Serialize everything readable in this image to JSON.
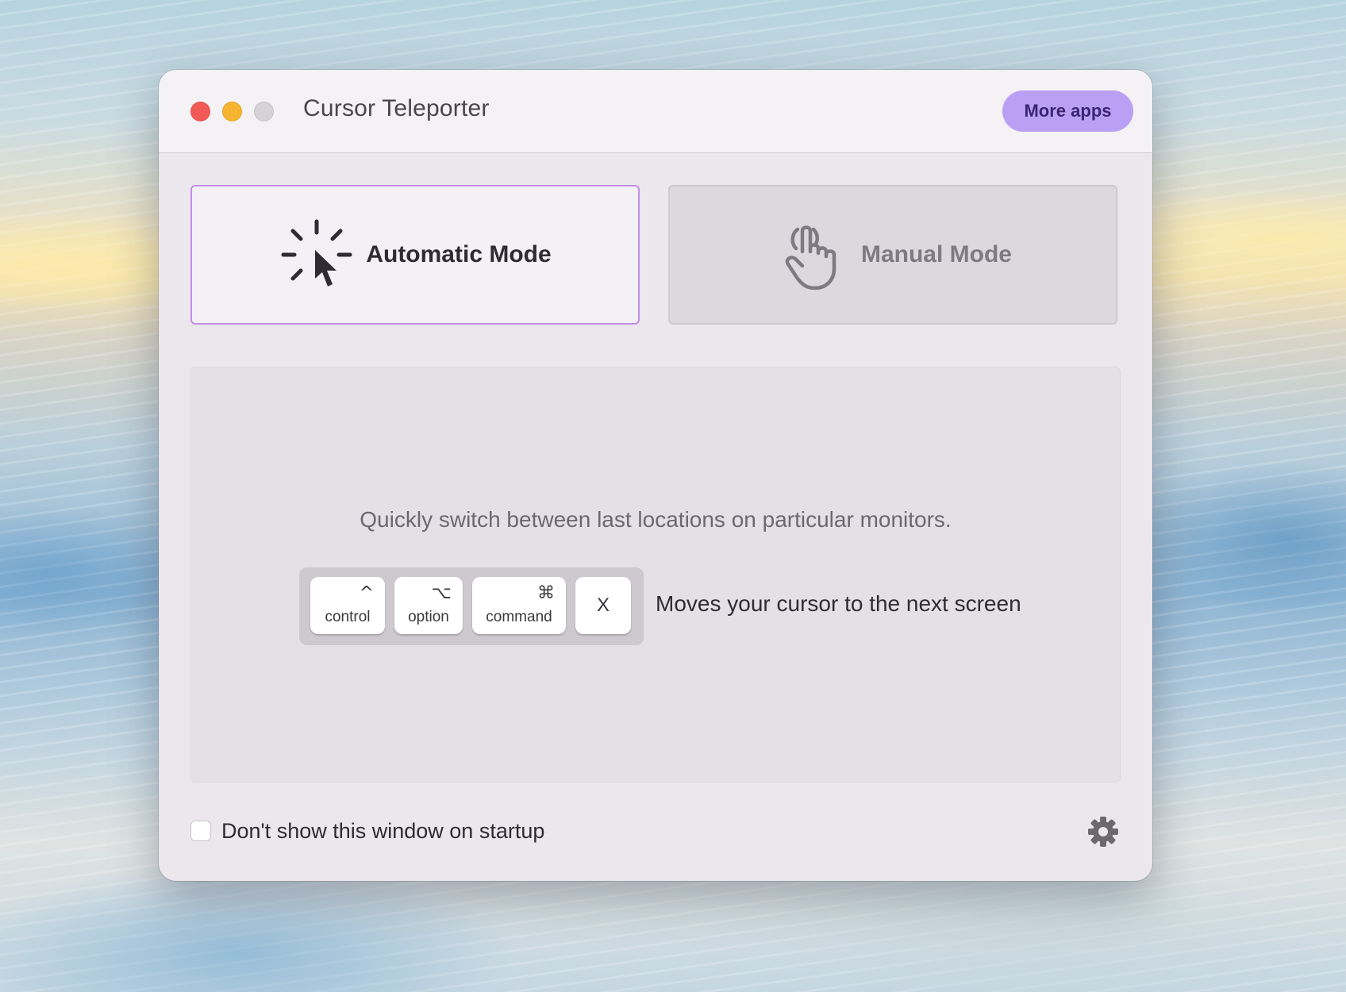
{
  "window": {
    "title": "Cursor Teleporter",
    "more_apps_label": "More apps"
  },
  "modes": [
    {
      "label": "Automatic Mode",
      "icon": "cursor-burst-icon",
      "selected": true
    },
    {
      "label": "Manual Mode",
      "icon": "hand-pointer-icon",
      "selected": false
    }
  ],
  "panel": {
    "description": "Quickly switch between last locations on particular monitors.",
    "shortcut": {
      "keys": [
        {
          "name": "control",
          "symbol": "^"
        },
        {
          "name": "option",
          "symbol": "⌥"
        },
        {
          "name": "command",
          "symbol": "⌘"
        },
        {
          "name": "",
          "symbol": "X"
        }
      ],
      "description": "Moves your cursor to the next screen"
    }
  },
  "footer": {
    "startup_checkbox_label": "Don't show this window on startup",
    "startup_checkbox_checked": false,
    "settings_icon": "gear-icon"
  },
  "colors": {
    "accent": "#b9a0f5",
    "accent_text": "#3a2470",
    "selected_border": "#c48ee8",
    "close": "#f25a55",
    "minimize": "#f6b430"
  }
}
